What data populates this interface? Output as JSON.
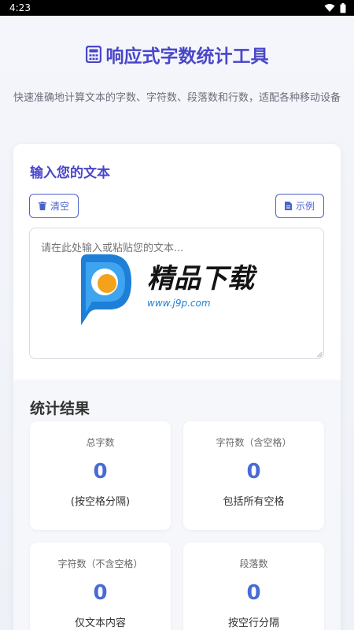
{
  "status_bar": {
    "time": "4:23"
  },
  "header": {
    "title": "响应式字数统计工具",
    "subtitle": "快速准确地计算文本的字数、字符数、段落数和行数，适配各种移动设备"
  },
  "input_section": {
    "title": "输入您的文本",
    "clear_label": "清空",
    "example_label": "示例",
    "placeholder": "请在此处输入或粘贴您的文本...",
    "value": ""
  },
  "watermark": {
    "brand_text": "精品下载",
    "url_text": "www.j9p.com"
  },
  "stats": {
    "title": "统计结果",
    "items": [
      {
        "label": "总字数",
        "value": "0",
        "note": "(按空格分隔)"
      },
      {
        "label": "字符数（含空格）",
        "value": "0",
        "note": "包括所有空格"
      },
      {
        "label": "字符数（不含空格）",
        "value": "0",
        "note": "仅文本内容"
      },
      {
        "label": "段落数",
        "value": "0",
        "note": "按空行分隔"
      }
    ]
  },
  "colors": {
    "accent": "#4a46c9",
    "button": "#4a63c9",
    "value": "#4a6bd6"
  }
}
